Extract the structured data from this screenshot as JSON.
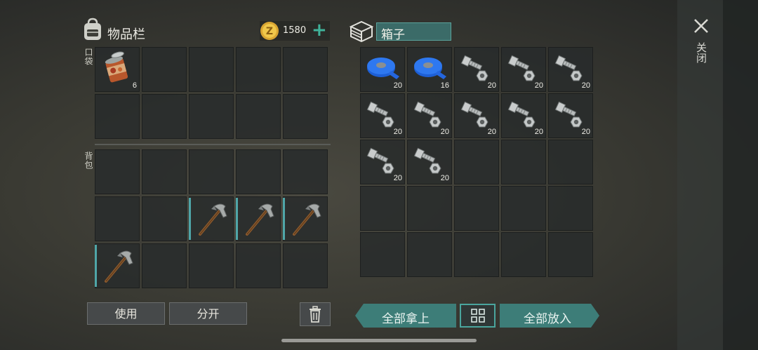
{
  "inventory": {
    "title": "物品栏",
    "coins": "1580",
    "pocket_label": "口袋",
    "backpack_label": "背包",
    "pocket_slots": [
      {
        "item": "canned-food",
        "count": "6",
        "equipped": false
      },
      {
        "item": "",
        "count": "",
        "equipped": false
      },
      {
        "item": "",
        "count": "",
        "equipped": false
      },
      {
        "item": "",
        "count": "",
        "equipped": false
      },
      {
        "item": "",
        "count": "",
        "equipped": false
      },
      {
        "item": "",
        "count": "",
        "equipped": false
      },
      {
        "item": "",
        "count": "",
        "equipped": false
      },
      {
        "item": "",
        "count": "",
        "equipped": false
      },
      {
        "item": "",
        "count": "",
        "equipped": false
      },
      {
        "item": "",
        "count": "",
        "equipped": false
      }
    ],
    "backpack_slots": [
      {
        "item": "",
        "count": "",
        "equipped": false
      },
      {
        "item": "",
        "count": "",
        "equipped": false
      },
      {
        "item": "",
        "count": "",
        "equipped": false
      },
      {
        "item": "",
        "count": "",
        "equipped": false
      },
      {
        "item": "",
        "count": "",
        "equipped": false
      },
      {
        "item": "",
        "count": "",
        "equipped": false
      },
      {
        "item": "",
        "count": "",
        "equipped": false
      },
      {
        "item": "pickaxe",
        "count": "",
        "equipped": true
      },
      {
        "item": "pickaxe",
        "count": "",
        "equipped": true
      },
      {
        "item": "pickaxe",
        "count": "",
        "equipped": true
      },
      {
        "item": "pickaxe",
        "count": "",
        "equipped": true
      },
      {
        "item": "",
        "count": "",
        "equipped": false
      },
      {
        "item": "",
        "count": "",
        "equipped": false
      },
      {
        "item": "",
        "count": "",
        "equipped": false
      },
      {
        "item": "",
        "count": "",
        "equipped": false
      }
    ],
    "use_button": "使用",
    "split_button": "分开"
  },
  "box": {
    "title": "箱子",
    "slots": [
      {
        "item": "blue-tape",
        "count": "20"
      },
      {
        "item": "blue-tape",
        "count": "16"
      },
      {
        "item": "bolts",
        "count": "20"
      },
      {
        "item": "bolts",
        "count": "20"
      },
      {
        "item": "bolts",
        "count": "20"
      },
      {
        "item": "bolts",
        "count": "20"
      },
      {
        "item": "bolts",
        "count": "20"
      },
      {
        "item": "bolts",
        "count": "20"
      },
      {
        "item": "bolts",
        "count": "20"
      },
      {
        "item": "bolts",
        "count": "20"
      },
      {
        "item": "bolts",
        "count": "20"
      },
      {
        "item": "bolts",
        "count": "20"
      },
      {
        "item": "",
        "count": ""
      },
      {
        "item": "",
        "count": ""
      },
      {
        "item": "",
        "count": ""
      },
      {
        "item": "",
        "count": ""
      },
      {
        "item": "",
        "count": ""
      },
      {
        "item": "",
        "count": ""
      },
      {
        "item": "",
        "count": ""
      },
      {
        "item": "",
        "count": ""
      },
      {
        "item": "",
        "count": ""
      },
      {
        "item": "",
        "count": ""
      },
      {
        "item": "",
        "count": ""
      },
      {
        "item": "",
        "count": ""
      },
      {
        "item": "",
        "count": ""
      }
    ],
    "take_all_button": "全部拿上",
    "put_all_button": "全部放入"
  },
  "close_label": "关闭",
  "icons": {
    "backpack": "backpack-icon",
    "coin": "coin-icon",
    "add": "plus-icon",
    "box": "box-icon",
    "trash": "trash-icon",
    "sort": "grid-icon",
    "close": "close-icon"
  }
}
